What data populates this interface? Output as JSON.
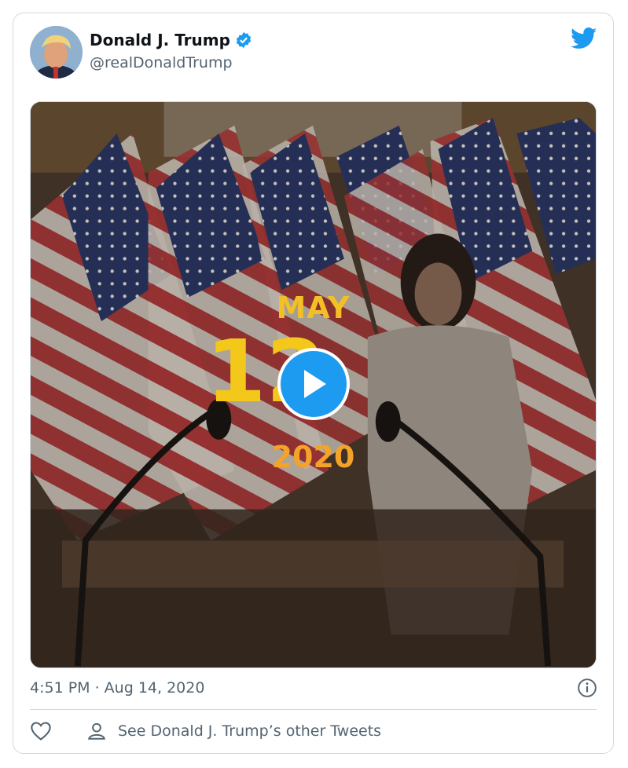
{
  "author": {
    "name": "Donald J. Trump",
    "handle": "@realDonaldTrump",
    "verified": true
  },
  "media": {
    "overlay_month": "MAY",
    "overlay_day": "12",
    "overlay_year": "2020",
    "play_icon": "play-icon"
  },
  "meta": {
    "timestamp": "4:51 PM · Aug 14, 2020",
    "info_icon": "info-icon"
  },
  "footer": {
    "like_icon": "heart-icon",
    "person_icon": "person-icon",
    "other_tweets_label": "See Donald J. Trump’s other Tweets"
  },
  "colors": {
    "twitter_blue": "#1d9bf0",
    "secondary_text": "#536471",
    "border": "#cfd9de",
    "overlay_gold": "#f3bf28"
  }
}
